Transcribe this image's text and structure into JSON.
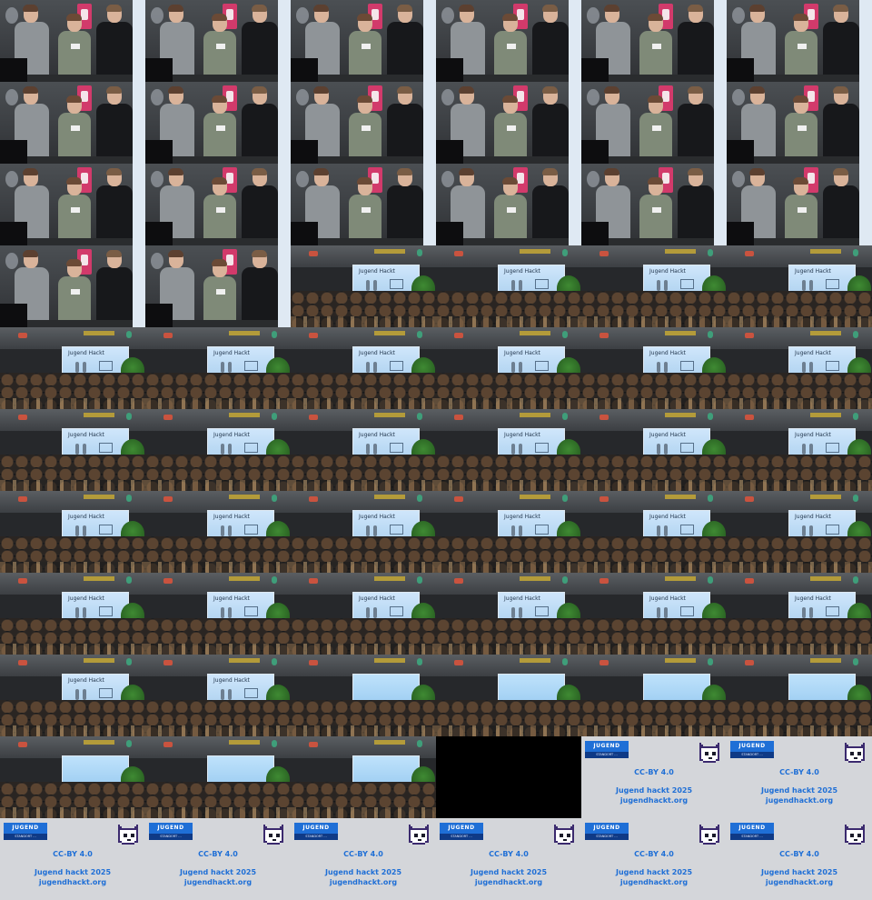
{
  "grid": {
    "columns": 6,
    "rows": 11
  },
  "tiles": [
    "stage",
    "stage",
    "stage",
    "stage",
    "stage",
    "stage",
    "stage",
    "stage",
    "stage",
    "stage",
    "stage",
    "stage",
    "stage",
    "stage",
    "stage",
    "stage",
    "stage",
    "stage",
    "stage",
    "stage",
    "audience",
    "audience",
    "audience",
    "audience",
    "audience",
    "audience",
    "audience",
    "audience",
    "audience",
    "audience",
    "audience",
    "audience",
    "audience",
    "audience",
    "audience",
    "audience",
    "audience",
    "audience",
    "audience",
    "audience",
    "audience",
    "audience",
    "audience",
    "audience",
    "audience",
    "audience",
    "audience",
    "audience",
    "audience",
    "audience",
    "audience-alt",
    "audience-alt",
    "audience-alt",
    "audience-alt",
    "audience-alt",
    "audience-alt",
    "audience-alt",
    "black",
    "card",
    "card",
    "card",
    "card",
    "card",
    "card",
    "card",
    "card"
  ],
  "slide_title": "Jugend Hackt",
  "end_card": {
    "logo_text": "JUGEND HACKT",
    "logo_subtext": "STANDORT …",
    "license": "CC-BY 4.0",
    "event": "Jugend hackt 2025",
    "url": "jugendhackt.org"
  },
  "colors": {
    "brand_blue": "#1f6fd6",
    "card_background": "#d4d6da",
    "jacket_black": "#17181b"
  },
  "icons": {
    "mascot": "pixel-cat-mascot-icon"
  }
}
